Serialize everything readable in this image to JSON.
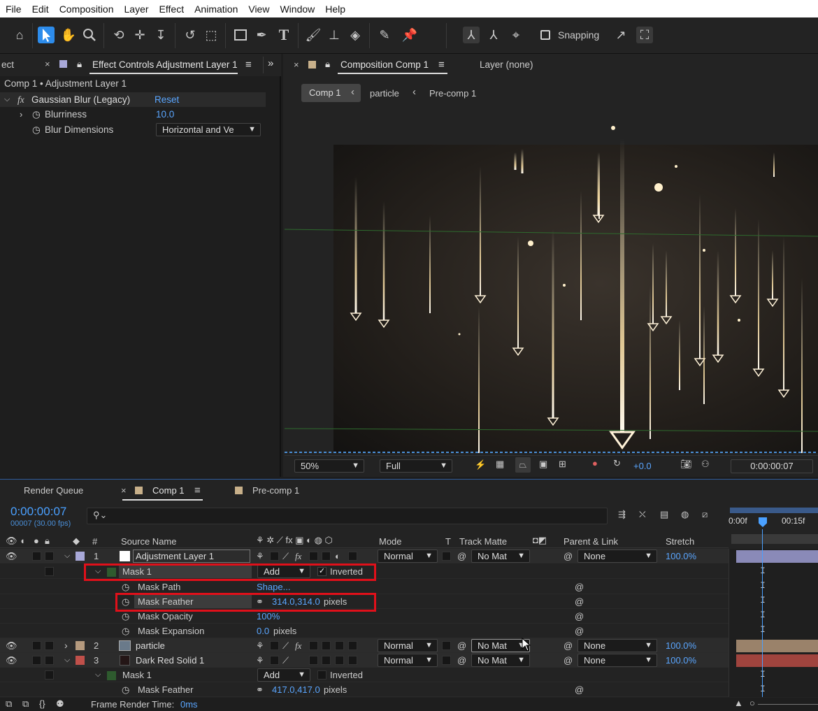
{
  "menu": [
    "File",
    "Edit",
    "Composition",
    "Layer",
    "Effect",
    "Animation",
    "View",
    "Window",
    "Help"
  ],
  "toolbar": {
    "snapping_label": "Snapping",
    "snapping_checked": false
  },
  "effect_panel": {
    "prev_tab": "ect",
    "tab_label": "Effect Controls Adjustment Layer 1",
    "breadcrumb": "Comp 1 • Adjustment Layer 1",
    "effect_name": "Gaussian Blur (Legacy)",
    "reset_label": "Reset",
    "props": [
      {
        "name": "Blurriness",
        "value": "10.0"
      },
      {
        "name": "Blur Dimensions",
        "value": "Horizontal and Ve"
      }
    ]
  },
  "comp_panel": {
    "tab_label": "Composition Comp 1",
    "layer_tab": "Layer (none)",
    "breadcrumbs": [
      "Comp 1",
      "particle",
      "Pre-comp 1"
    ],
    "footer": {
      "zoom": "50%",
      "quality": "Full",
      "exposure": "+0.0",
      "timecode": "0:00:00:07"
    }
  },
  "timeline": {
    "tabs": [
      "Render Queue",
      "Comp 1",
      "Pre-comp 1"
    ],
    "timecode": "0:00:00:07",
    "frame_info": "00007 (30.00 fps)",
    "search_placeholder": "",
    "ruler_labels": [
      "0:00f",
      "00:15f"
    ],
    "columns": {
      "num": "#",
      "source": "Source Name",
      "mode": "Mode",
      "t": "T",
      "matte": "Track Matte",
      "parent": "Parent & Link",
      "stretch": "Stretch"
    },
    "rows": [
      {
        "type": "layer",
        "num": "1",
        "name": "Adjustment Layer 1",
        "mode": "Normal",
        "matte": "No Mat",
        "parent": "None",
        "stretch": "100.0%",
        "color": "#a8a8d8"
      },
      {
        "type": "mask",
        "name": "Mask 1",
        "mode": "Add",
        "inverted_label": "Inverted",
        "inverted": true
      },
      {
        "type": "prop",
        "name": "Mask Path",
        "value": "Shape..."
      },
      {
        "type": "prop",
        "name": "Mask Feather",
        "value": "314.0,314.0",
        "unit": "pixels"
      },
      {
        "type": "prop",
        "name": "Mask Opacity",
        "value": "100%"
      },
      {
        "type": "prop",
        "name": "Mask Expansion",
        "value": "0.0",
        "unit": "pixels"
      },
      {
        "type": "layer",
        "num": "2",
        "name": "particle",
        "mode": "Normal",
        "matte": "No Mat",
        "parent": "None",
        "stretch": "100.0%",
        "color": "#b59a7e"
      },
      {
        "type": "layer",
        "num": "3",
        "name": "Dark Red Solid 1",
        "mode": "Normal",
        "matte": "No Mat",
        "parent": "None",
        "stretch": "100.0%",
        "color": "#c0504a"
      },
      {
        "type": "mask",
        "name": "Mask 1",
        "mode": "Add",
        "inverted_label": "Inverted",
        "inverted": false
      },
      {
        "type": "prop",
        "name": "Mask Feather",
        "value": "417.0,417.0",
        "unit": "pixels"
      }
    ],
    "status": {
      "label": "Frame Render Time:",
      "value": "0ms"
    }
  },
  "colors": {
    "accent": "#2d8ceb",
    "value_blue": "#5aa6ff",
    "highlight": "#e0101a"
  }
}
